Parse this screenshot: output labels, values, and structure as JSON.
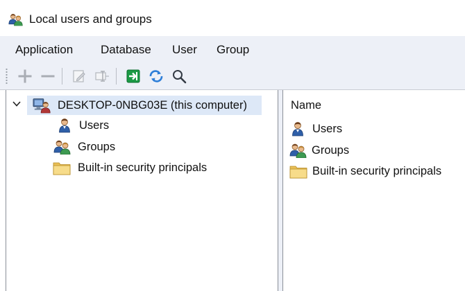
{
  "window": {
    "title": "Local users and groups"
  },
  "menu": {
    "items": [
      {
        "label": "Application"
      },
      {
        "label": "Database"
      },
      {
        "label": "User"
      },
      {
        "label": "Group"
      }
    ]
  },
  "toolbar": {
    "buttons": [
      {
        "icon": "add-icon",
        "enabled": false
      },
      {
        "icon": "remove-icon",
        "enabled": false
      },
      {
        "icon": "edit-icon",
        "enabled": false
      },
      {
        "icon": "properties-icon",
        "enabled": false
      },
      {
        "icon": "export-icon",
        "enabled": true
      },
      {
        "icon": "refresh-icon",
        "enabled": true
      },
      {
        "icon": "search-icon",
        "enabled": true
      }
    ]
  },
  "tree": {
    "root": {
      "label": "DESKTOP-0NBG03E (this computer)",
      "icon": "computer-user-icon",
      "expanded": true
    },
    "children": [
      {
        "label": "Users",
        "icon": "user-icon"
      },
      {
        "label": "Groups",
        "icon": "group-icon"
      },
      {
        "label": "Built-in security principals",
        "icon": "folder-icon"
      }
    ]
  },
  "list": {
    "column_header": "Name",
    "items": [
      {
        "label": "Users",
        "icon": "user-icon"
      },
      {
        "label": "Groups",
        "icon": "group-icon"
      },
      {
        "label": "Built-in security principals",
        "icon": "folder-icon"
      }
    ]
  },
  "colors": {
    "menubar_bg": "#edf0f7",
    "selection_bg": "#dde8f7",
    "folder": "#f4d57a",
    "export_green": "#1b9a45",
    "refresh_blue": "#2d7ed8"
  }
}
